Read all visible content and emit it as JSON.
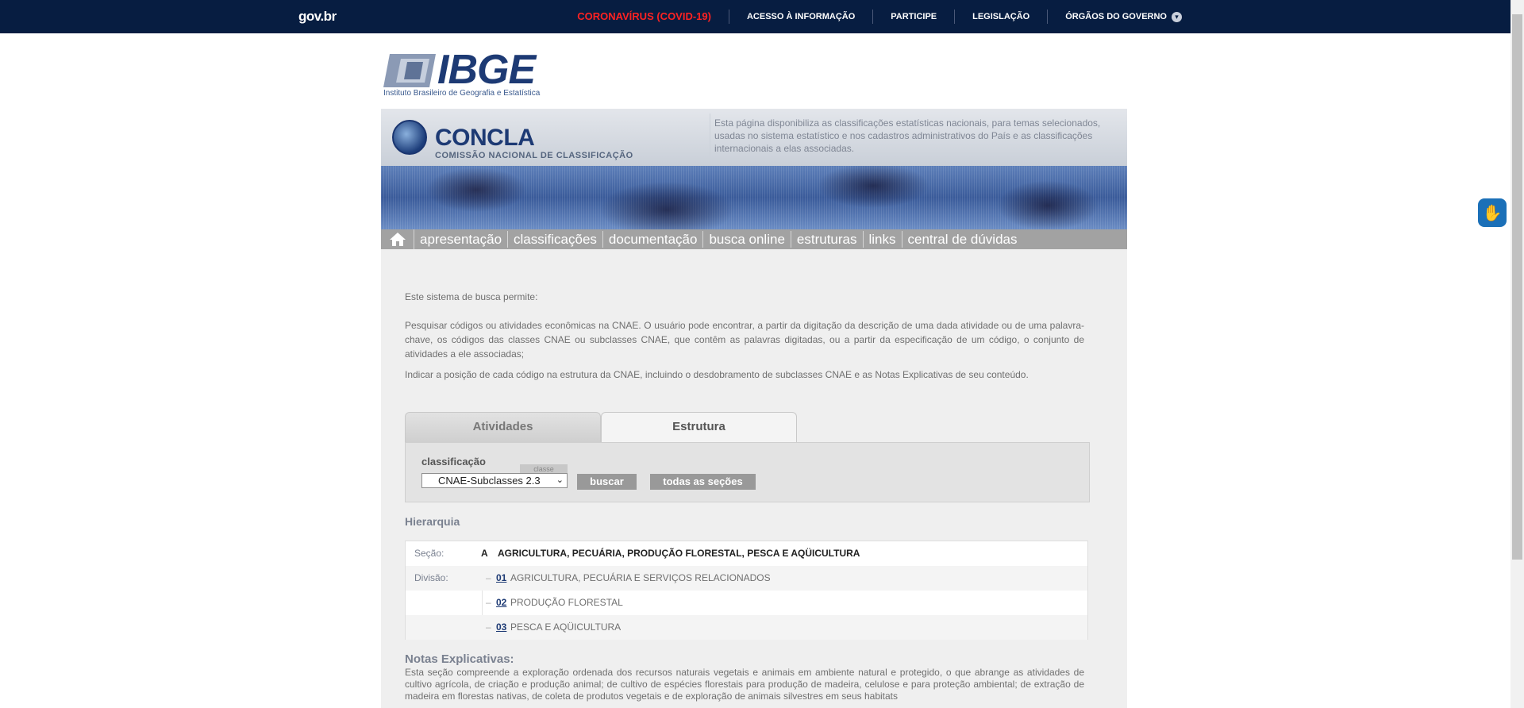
{
  "govbar": {
    "logo": "gov.br",
    "links": [
      "CORONAVÍRUS (COVID-19)",
      "ACESSO À INFORMAÇÃO",
      "PARTICIPE",
      "LEGISLAÇÃO",
      "ÓRGÃOS DO GOVERNO"
    ]
  },
  "ibge": {
    "title": "IBGE",
    "subtitle": "Instituto Brasileiro de Geografia e Estatística"
  },
  "concla": {
    "title": "CONCLA",
    "subtitle": "COMISSÃO NACIONAL DE CLASSIFICAÇÃO",
    "description": "Esta página disponibiliza as classificações estatísticas nacionais, para temas selecionados, usadas no sistema estatístico e nos cadastros administrativos do País e as classificações internacionais a elas associadas."
  },
  "menu": {
    "items": [
      "apresentação",
      "classificações",
      "documentação",
      "busca online",
      "estruturas",
      "links",
      "central de dúvidas"
    ]
  },
  "intro": {
    "p1": "Este sistema de busca permite:",
    "p2": "Pesquisar códigos ou atividades econômicas na CNAE. O usuário pode encontrar, a partir da digitação da descrição de uma dada atividade ou de uma palavra-chave, os códigos das classes CNAE ou subclasses CNAE, que contêm as palavras digitadas, ou a partir da especificação de um código, o conjunto de atividades a ele associadas;",
    "p3": "Indicar a posição de cada código na estrutura da CNAE, incluindo o desdobramento de subclasses CNAE e as Notas Explicativas de seu conteúdo."
  },
  "tabs": [
    "Atividades",
    "Estrutura"
  ],
  "search": {
    "label": "classificação",
    "tag": "classe",
    "selected": "CNAE-Subclasses 2.3",
    "buscar": "buscar",
    "todas": "todas as seções"
  },
  "hierarquia": {
    "title": "Hierarquia",
    "secao_label": "Seção:",
    "secao_code": "A",
    "secao_text": "AGRICULTURA, PECUÁRIA, PRODUÇÃO FLORESTAL, PESCA E AQÜICULTURA",
    "divisao_label": "Divisão:",
    "divisoes": [
      {
        "code": "01",
        "text": "AGRICULTURA, PECUÁRIA E SERVIÇOS RELACIONADOS"
      },
      {
        "code": "02",
        "text": "PRODUÇÃO FLORESTAL"
      },
      {
        "code": "03",
        "text": "PESCA E AQÜICULTURA"
      }
    ]
  },
  "notas": {
    "title": "Notas Explicativas:",
    "text": "Esta seção compreende a exploração ordenada dos recursos naturais vegetais e animais em ambiente natural e protegido, o que abrange as atividades de cultivo agrícola, de criação e produção animal; de cultivo de espécies florestais para produção de madeira, celulose e para proteção ambiental; de extração de madeira em florestas nativas, de coleta de produtos vegetais e de exploração de animais silvestres em seus habitats"
  }
}
